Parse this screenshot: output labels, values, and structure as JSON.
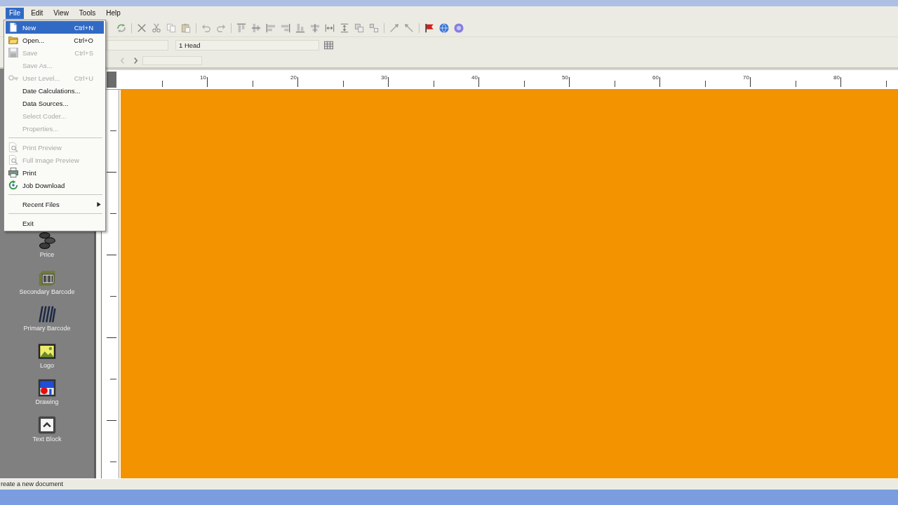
{
  "menu_bar": [
    {
      "label": "File",
      "selected": true
    },
    {
      "label": "Edit",
      "selected": false
    },
    {
      "label": "View",
      "selected": false
    },
    {
      "label": "Tools",
      "selected": false
    },
    {
      "label": "Help",
      "selected": false
    }
  ],
  "file_menu": [
    {
      "kind": "item",
      "label": "New",
      "shortcut": "Ctrl+N",
      "disabled": false,
      "selected": true
    },
    {
      "kind": "item",
      "label": "Open...",
      "shortcut": "Ctrl+O",
      "disabled": false,
      "selected": false
    },
    {
      "kind": "item",
      "label": "Save",
      "shortcut": "Ctrl+S",
      "disabled": true,
      "selected": false
    },
    {
      "kind": "item",
      "label": "Save As...",
      "disabled": true,
      "selected": false
    },
    {
      "kind": "item",
      "label": "User Level...",
      "shortcut": "Ctrl+U",
      "disabled": true,
      "selected": false
    },
    {
      "kind": "item",
      "label": "Date Calculations...",
      "disabled": false,
      "selected": false
    },
    {
      "kind": "item",
      "label": "Data Sources...",
      "disabled": false,
      "selected": false
    },
    {
      "kind": "item",
      "label": "Select Coder...",
      "disabled": true,
      "selected": false
    },
    {
      "kind": "item",
      "label": "Properties...",
      "disabled": true,
      "selected": false
    },
    {
      "kind": "separator"
    },
    {
      "kind": "item",
      "label": "Print Preview",
      "disabled": true,
      "selected": false
    },
    {
      "kind": "item",
      "label": "Full Image Preview",
      "disabled": true,
      "selected": false
    },
    {
      "kind": "item",
      "label": "Print",
      "disabled": false,
      "selected": false
    },
    {
      "kind": "item",
      "label": "Job Download",
      "disabled": false,
      "selected": false
    },
    {
      "kind": "separator"
    },
    {
      "kind": "submenu",
      "label": "Recent Files",
      "disabled": false,
      "selected": false
    },
    {
      "kind": "separator"
    },
    {
      "kind": "item",
      "label": "Exit",
      "disabled": false,
      "selected": false
    }
  ],
  "toolbar": {
    "head_field": {
      "value": "1 Head"
    }
  },
  "ruler": {
    "labels": [
      "10",
      "20",
      "30",
      "40",
      "50",
      "60",
      "70",
      "80"
    ]
  },
  "tool_palette": [
    {
      "label": "Price"
    },
    {
      "label": "Secondary Barcode"
    },
    {
      "label": "Primary Barcode"
    },
    {
      "label": "Logo"
    },
    {
      "label": "Drawing"
    },
    {
      "label": "Text Block"
    }
  ],
  "status_bar": {
    "text": "reate a new document"
  }
}
